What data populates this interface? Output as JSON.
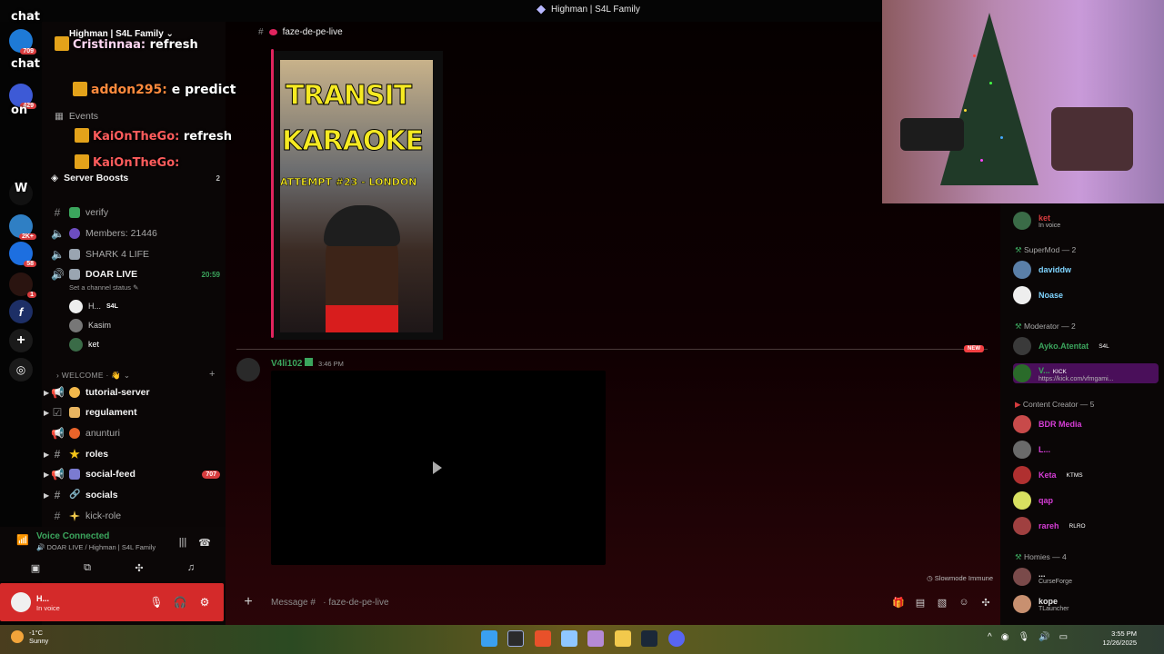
{
  "window": {
    "title": "Highman | S4L Family"
  },
  "server": {
    "name": "Highman | S4L Family"
  },
  "overlay_chat": [
    {
      "user": "Cristinnaa:",
      "text": "refresh"
    },
    {
      "user": "addon295:",
      "text": "e predict"
    },
    {
      "user": "KaiOnTheGo:",
      "text": "refresh"
    },
    {
      "user": "KaiOnTheGo:",
      "text": ""
    }
  ],
  "overlay_misc": {
    "chat1": "chat",
    "chat2": "chat",
    "on": "on",
    "w": "W"
  },
  "rail": {
    "badges": [
      "709",
      "429",
      "2K+",
      "58",
      "1"
    ]
  },
  "sidebar": {
    "events": "Events",
    "server_boosts": "Server Boosts",
    "server_boosts_count": "2",
    "channels": [
      {
        "label": "verify",
        "bold": false
      },
      {
        "label": "Members: 21446",
        "bold": false
      },
      {
        "label": "SHARK 4 LIFE",
        "bold": false
      },
      {
        "label": "DOAR LIVE",
        "bold": true,
        "time": "20:59"
      }
    ],
    "set_status": "Set a channel status",
    "voice_users": [
      {
        "name": "H...",
        "tag": "S4L"
      },
      {
        "name": "Kasim"
      },
      {
        "name": "ket"
      }
    ],
    "category_welcome": "WELCOME",
    "welcome_channels": [
      {
        "label": "tutorial-server",
        "bold": true
      },
      {
        "label": "regulament",
        "bold": true
      },
      {
        "label": "anunturi",
        "bold": false
      },
      {
        "label": "roles",
        "bold": true
      },
      {
        "label": "social-feed",
        "bold": true,
        "count": "707"
      },
      {
        "label": "socials",
        "bold": true
      },
      {
        "label": "kick-role",
        "bold": false
      }
    ]
  },
  "voice_panel": {
    "status": "Voice Connected",
    "channel": "DOAR LIVE / Highman | S4L Family"
  },
  "user_panel": {
    "name": "H...",
    "status": "In voice"
  },
  "main": {
    "channel_name": "faze-de-pe-live",
    "thumbnail": {
      "line1": "TRANSIT",
      "line2": "KARAOKE",
      "line3": "ATTEMPT #23 - LONDON"
    },
    "new_badge": "NEW",
    "message": {
      "author": "V4li102",
      "time": "3:46 PM"
    },
    "slowmode": "Slowmode Immune",
    "composer_placeholder": "Message #   · faze-de-pe-live"
  },
  "members": {
    "top_user": {
      "name": "ket",
      "status": "In voice"
    },
    "categories": [
      {
        "label": "SuperMod — 2",
        "members": [
          {
            "name": "daviddw",
            "color": "#7fd4ff"
          },
          {
            "name": "Noase",
            "color": "#7fd4ff"
          }
        ]
      },
      {
        "label": "Moderator — 2",
        "members": [
          {
            "name": "Ayko.Atentat",
            "color": "#3ba55d",
            "tag": "S4L"
          },
          {
            "name": "V...",
            "color": "#3ba55d",
            "tag": "KICK",
            "sub": "https://kick.com/vfmgami..."
          }
        ]
      },
      {
        "label": "Content Creator — 5",
        "members": [
          {
            "name": "BDR Media",
            "color": "#d63dd6"
          },
          {
            "name": "L...",
            "color": "#d63dd6"
          },
          {
            "name": "Keta",
            "color": "#d63dd6",
            "tag": "KTMS"
          },
          {
            "name": "qap",
            "color": "#d63dd6"
          },
          {
            "name": "rareh",
            "color": "#d63dd6",
            "tag": "RLRO"
          }
        ]
      },
      {
        "label": "Homies — 4",
        "members": [
          {
            "name": "...",
            "color": "#e8e8e8",
            "sub": "CurseForge"
          },
          {
            "name": "kope",
            "color": "#e8e8e8",
            "sub": "TLauncher"
          }
        ]
      }
    ]
  },
  "taskbar": {
    "temp": "-1°C",
    "weather": "Sunny",
    "time": "3:55 PM",
    "date": "12/26/2025"
  },
  "colors": {
    "accent_red": "#d42a2a",
    "online_green": "#3ba55d",
    "embed_pink": "#e0245e",
    "creator_magenta": "#d63dd6"
  }
}
